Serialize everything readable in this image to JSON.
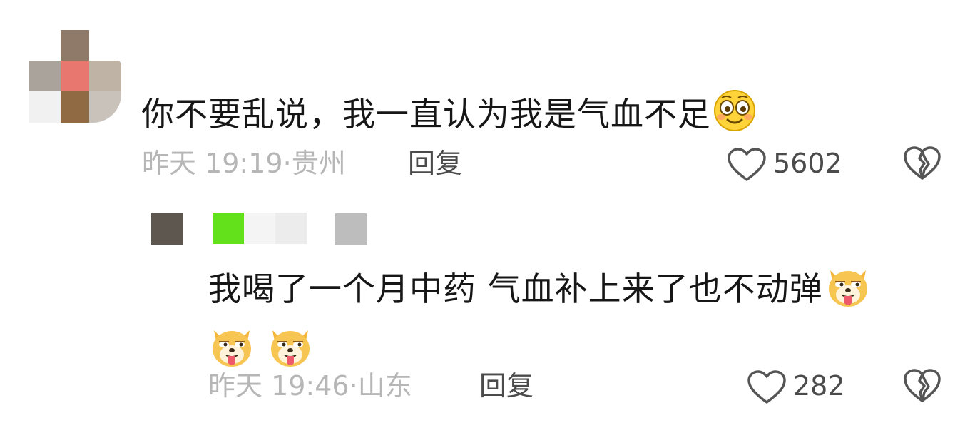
{
  "comment": {
    "text": "你不要乱说，我一直认为我是气血不足",
    "emoji": "smiling-face-emoji",
    "timestamp": "昨天 19:19",
    "location": "贵州",
    "reply_label": "回复",
    "like_count": "5602"
  },
  "reply": {
    "text": "我喝了一个月中药 气血补上来了也不动弹",
    "emoji": "doge-tongue-emoji",
    "timestamp": "昨天 19:46",
    "location": "山东",
    "reply_label": "回复",
    "like_count": "282"
  },
  "meta_separator": "·",
  "icons": {
    "like": "heart-outline-icon",
    "dislike": "broken-heart-icon"
  },
  "colors": {
    "text_primary": "#161616",
    "text_meta": "#b6b6b6",
    "text_action": "#4b4b4b",
    "mosaic_green": "#63e11b"
  }
}
